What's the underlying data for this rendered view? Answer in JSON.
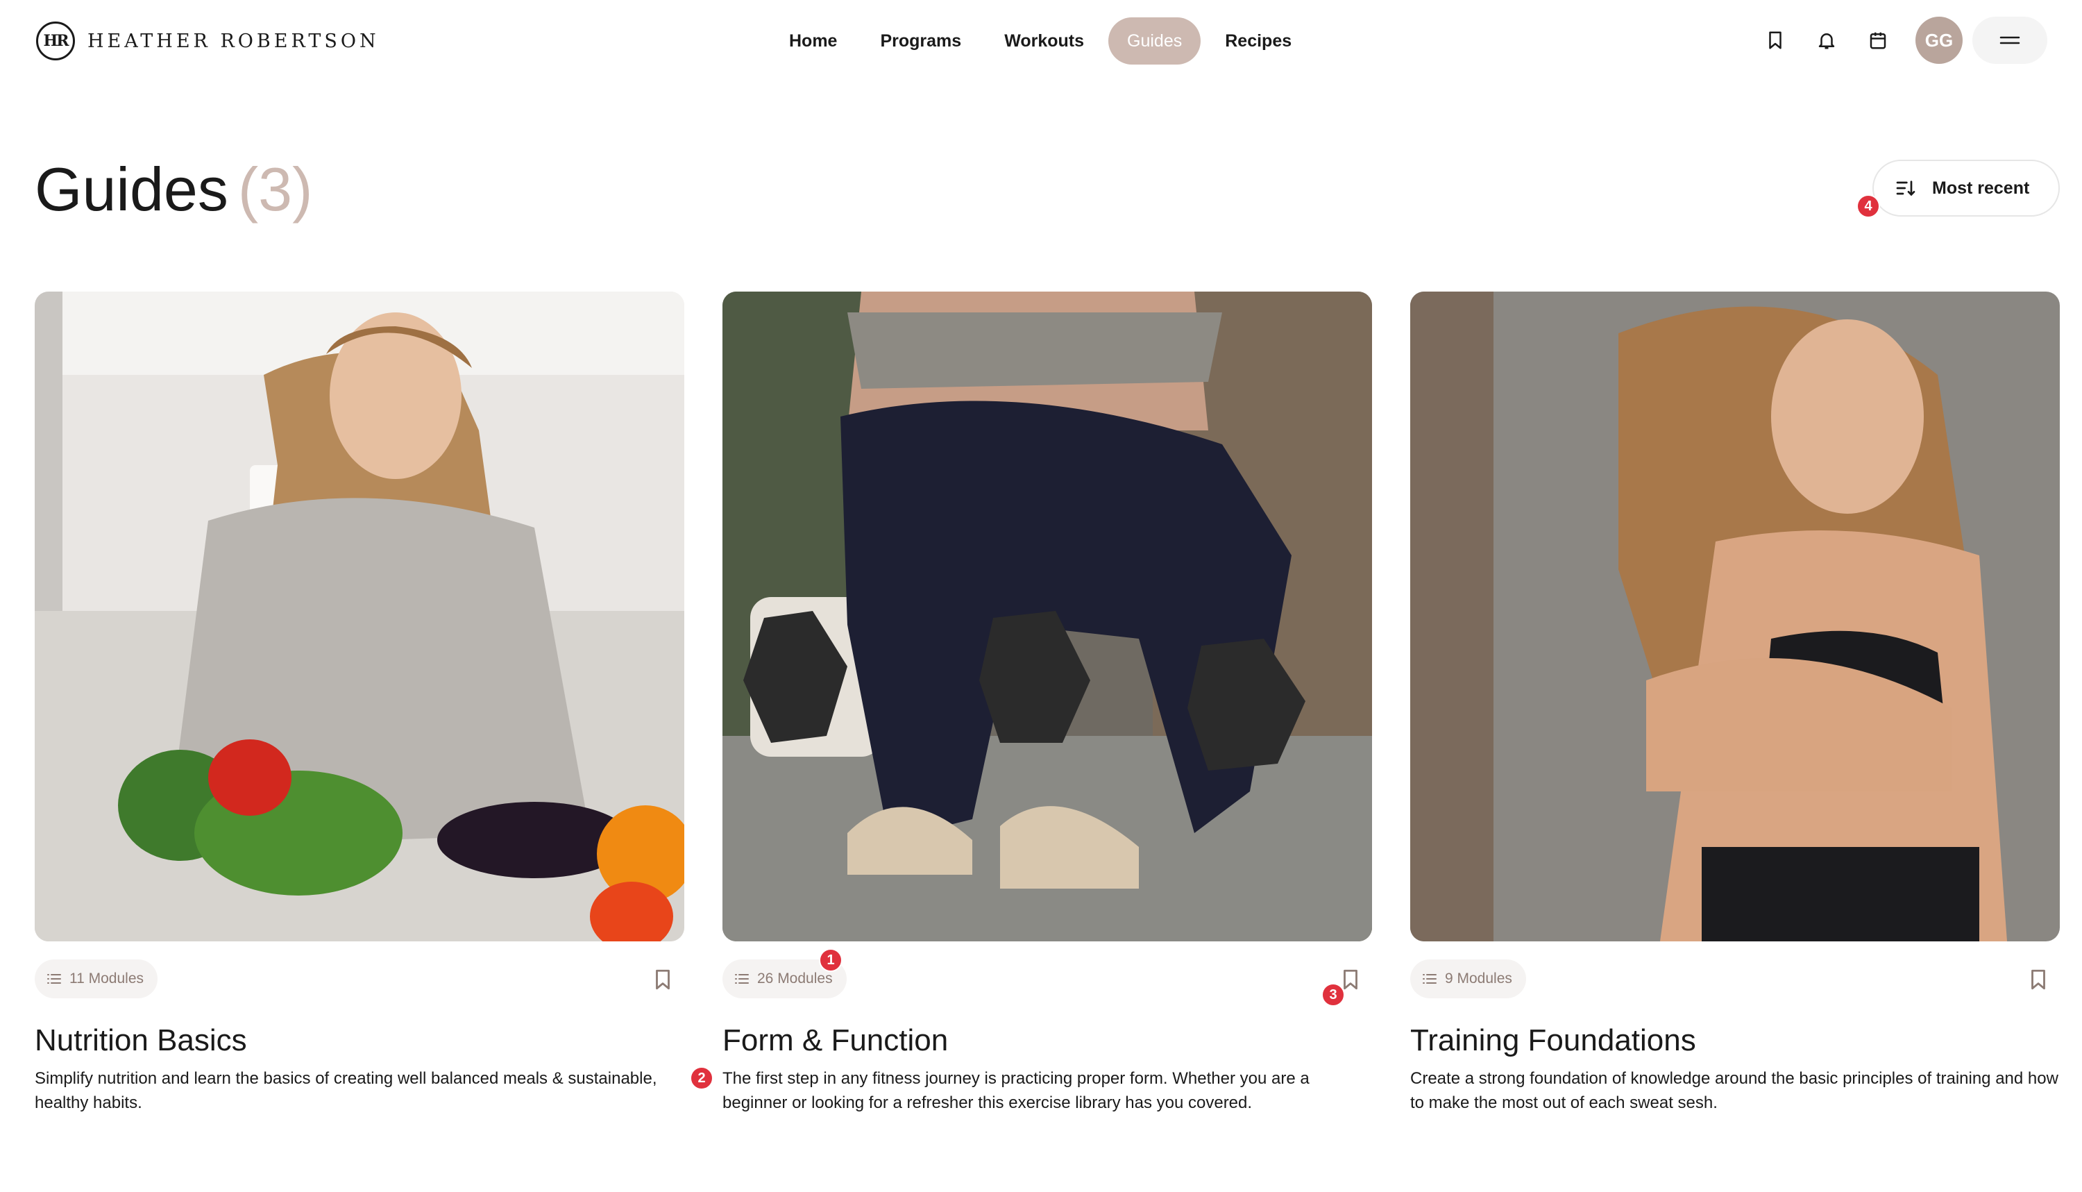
{
  "brand": {
    "logo_mark": "HR",
    "name": "HEATHER ROBERTSON"
  },
  "nav": {
    "items": [
      {
        "label": "Home",
        "active": false
      },
      {
        "label": "Programs",
        "active": false
      },
      {
        "label": "Workouts",
        "active": false
      },
      {
        "label": "Guides",
        "active": true
      },
      {
        "label": "Recipes",
        "active": false
      }
    ]
  },
  "header_icons": [
    "bookmark-icon",
    "bell-icon",
    "calendar-icon"
  ],
  "user": {
    "initials": "GG"
  },
  "page": {
    "title": "Guides",
    "count": "(3)"
  },
  "sort": {
    "label": "Most recent"
  },
  "markers": [
    "1",
    "2",
    "3",
    "4"
  ],
  "cards": [
    {
      "modules": "11 Modules",
      "title": "Nutrition Basics",
      "description": "Simplify nutrition and learn the basics of creating well balanced meals & sustainable, healthy habits."
    },
    {
      "modules": "26 Modules",
      "title": "Form & Function",
      "description": "The first step in any fitness journey is practicing proper form. Whether you are a beginner or looking for a refresher this exercise library has you covered."
    },
    {
      "modules": "9 Modules",
      "title": "Training Foundations",
      "description": "Create a strong foundation of knowledge around the basic principles of training and how to make the most out of each sweat sesh."
    }
  ],
  "colors": {
    "accent": "#cdb9b1",
    "avatar": "#b9a59c",
    "marker": "#e0313d",
    "module_text": "#8c7b74"
  }
}
